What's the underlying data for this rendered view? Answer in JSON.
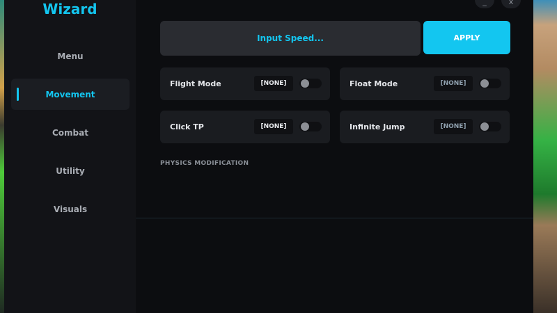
{
  "app": {
    "title": "Wizard"
  },
  "sidebar": {
    "items": [
      {
        "label": "Menu",
        "active": false
      },
      {
        "label": "Movement",
        "active": true
      },
      {
        "label": "Combat",
        "active": false
      },
      {
        "label": "Utility",
        "active": false
      },
      {
        "label": "Visuals",
        "active": false
      }
    ]
  },
  "window_controls": {
    "minimize_label": "_",
    "close_label": "x"
  },
  "speed": {
    "placeholder": "Input Speed...",
    "apply_label": "APPLY"
  },
  "toggles": [
    {
      "label": "Flight Mode",
      "keybind": "[NONE]",
      "enabled": false
    },
    {
      "label": "Float Mode",
      "keybind": "[NONE]",
      "enabled": false
    },
    {
      "label": "Click TP",
      "keybind": "[NONE]",
      "enabled": false
    },
    {
      "label": "Infinite Jump",
      "keybind": "[NONE]",
      "enabled": false
    }
  ],
  "section": {
    "title": "PHYSICS MODIFICATION"
  },
  "colors": {
    "accent": "#13c6f0",
    "panel": "#0c0d10",
    "sidebar": "#121317",
    "card": "#1a1c20"
  }
}
